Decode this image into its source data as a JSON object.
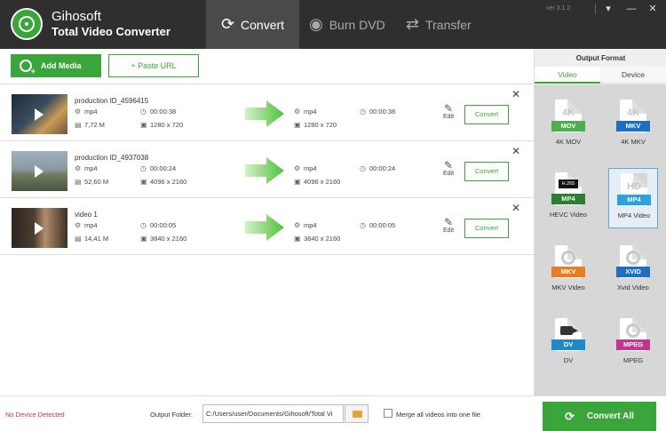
{
  "app": {
    "brand_line1": "Gihosoft",
    "brand_line2": "Total Video Converter",
    "version": "ver 3.1.2"
  },
  "nav": {
    "tabs": [
      {
        "label": "Convert",
        "icon": "refresh-icon"
      },
      {
        "label": "Burn DVD",
        "icon": "disc-icon"
      },
      {
        "label": "Transfer",
        "icon": "transfer-icon"
      }
    ]
  },
  "window_controls": {
    "menu": "▾",
    "minimize": "—",
    "close": "✕"
  },
  "toolbar": {
    "add_media": "Add Media",
    "paste_url": "+ Paste URL"
  },
  "files": [
    {
      "name": "production ID_4596415",
      "src_format": "mp4",
      "src_duration": "00:00:38",
      "src_size": "7,72 M",
      "src_resolution": "1280 x 720",
      "out_format": "mp4",
      "out_duration": "00:00:38",
      "out_resolution": "1280 x 720",
      "edit": "Edit",
      "convert": "Convert",
      "thumb_colors": [
        "#2b3a4a",
        "#c29a52"
      ]
    },
    {
      "name": "production ID_4937038",
      "src_format": "mp4",
      "src_duration": "00:00:24",
      "src_size": "52,60 M",
      "src_resolution": "4096 x 2160",
      "out_format": "mp4",
      "out_duration": "00:00:24",
      "out_resolution": "4096 x 2160",
      "edit": "Edit",
      "convert": "Convert",
      "thumb_colors": [
        "#8ea0ab",
        "#5c6a52"
      ]
    },
    {
      "name": "video 1",
      "src_format": "mp4",
      "src_duration": "00:00:05",
      "src_size": "14,41 M",
      "src_resolution": "3840 x 2160",
      "out_format": "mp4",
      "out_duration": "00:00:05",
      "out_resolution": "3840 x 2160",
      "edit": "Edit",
      "convert": "Convert",
      "thumb_colors": [
        "#3a3028",
        "#b89070"
      ]
    }
  ],
  "output_format": {
    "title": "Output Format",
    "tabs": [
      "Video",
      "Device"
    ],
    "formats": [
      {
        "label": "4K MOV",
        "badge": "MOV",
        "glyph": "4K",
        "color": "#4cb050"
      },
      {
        "label": "4K MKV",
        "badge": "MKV",
        "glyph": "4K",
        "color": "#1e6fc2"
      },
      {
        "label": "HEVC Video",
        "badge": "MP4",
        "glyph": "H.265",
        "color": "#2e7d32"
      },
      {
        "label": "MP4 Video",
        "badge": "MP4",
        "glyph": "HD",
        "color": "#29a3e0",
        "selected": true
      },
      {
        "label": "MKV Video",
        "badge": "MKV",
        "glyph": "reel",
        "color": "#e67e22"
      },
      {
        "label": "Xvid Video",
        "badge": "XVID",
        "glyph": "reel",
        "color": "#1e6fc2"
      },
      {
        "label": "DV",
        "badge": "DV",
        "glyph": "camera",
        "color": "#1e88c8"
      },
      {
        "label": "MPEG",
        "badge": "MPEG",
        "glyph": "reel",
        "color": "#c2368f"
      }
    ]
  },
  "footer": {
    "device_status": "No Device Detected",
    "output_folder_label": "Output Folder:",
    "output_folder_value": "C:/Users/user/Documents/Gihosoft/Total Vi",
    "merge_label": "Merge all videos into one file",
    "convert_all": "Convert All"
  },
  "colors": {
    "accent": "#3aa53a",
    "header_bg": "#2f2f2f",
    "alert": "#d32f2f"
  }
}
